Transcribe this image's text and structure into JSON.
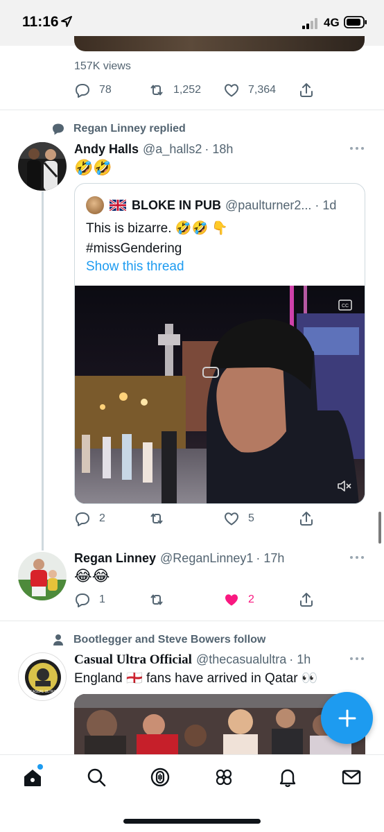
{
  "status_bar": {
    "time": "11:16",
    "network": "4G"
  },
  "previous_tweet": {
    "views": "157K views",
    "replies": "78",
    "retweets": "1,252",
    "likes": "7,364"
  },
  "reply_tweet": {
    "context": "Regan Linney replied",
    "name": "Andy Halls",
    "handle": "@a_halls2",
    "time": "· 18h",
    "text": "🤣🤣",
    "quote": {
      "name": "BLOKE IN PUB",
      "handle": "@paulturner2... · 1d",
      "text_line1": "This is bizarre. 🤣🤣 👇",
      "text_line2": "#missGendering",
      "show_thread": "Show this thread"
    },
    "replies": "2",
    "retweets": "",
    "likes": "5"
  },
  "regan_tweet": {
    "name": "Regan Linney",
    "handle": "@ReganLinney1",
    "time": "· 17h",
    "text": "😂😂",
    "replies": "1",
    "retweets": "",
    "likes": "2",
    "liked": true
  },
  "casual_tweet": {
    "context": "Bootlegger and Steve Bowers follow",
    "name": "Casual Ultra Official",
    "handle": "@thecasualultra",
    "time": "· 1h",
    "text": "England 🏴󠁧󠁢󠁥󠁮󠁧󠁿 fans have arrived in Qatar 👀",
    "avatar_text": "CASUAL ULTRA"
  },
  "colors": {
    "accent": "#1d9bf0",
    "like": "#f91880",
    "secondary": "#536471"
  },
  "tabs": [
    "home-icon",
    "search-icon",
    "spaces-icon",
    "communities-icon",
    "notifications-icon",
    "messages-icon"
  ]
}
